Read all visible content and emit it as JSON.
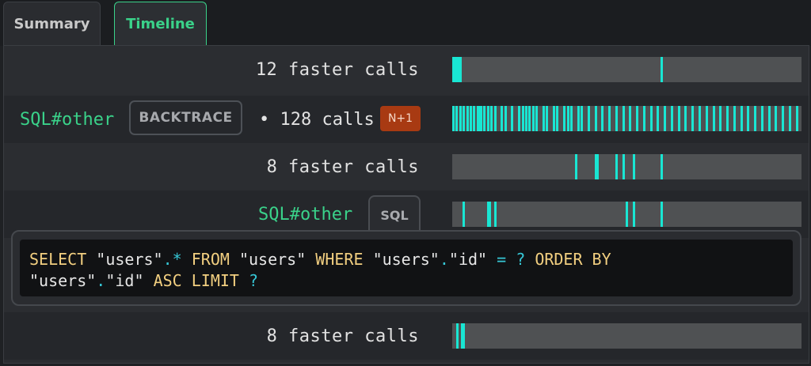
{
  "tabs": [
    {
      "label": "Summary",
      "active": false
    },
    {
      "label": "Timeline",
      "active": true
    }
  ],
  "rows": {
    "row1": {
      "text": "12 faster calls",
      "marks": [
        0.0,
        0.005,
        0.01,
        0.015,
        0.02,
        0.6
      ]
    },
    "row2": {
      "name": "SQL#other",
      "backtrace_label": "BACKTRACE",
      "calls_text": "• 128 calls",
      "badge": "N+1",
      "marks": [
        0.0,
        0.01,
        0.02,
        0.03,
        0.04,
        0.05,
        0.06,
        0.07,
        0.075,
        0.08,
        0.09,
        0.1,
        0.11,
        0.12,
        0.14,
        0.15,
        0.17,
        0.19,
        0.2,
        0.21,
        0.22,
        0.23,
        0.24,
        0.26,
        0.27,
        0.29,
        0.3,
        0.32,
        0.33,
        0.34,
        0.36,
        0.37,
        0.39,
        0.41,
        0.43,
        0.45,
        0.47,
        0.49,
        0.51,
        0.53,
        0.55,
        0.57,
        0.59,
        0.61,
        0.63,
        0.65,
        0.67,
        0.69,
        0.71,
        0.73,
        0.75,
        0.77,
        0.79,
        0.81,
        0.83,
        0.85,
        0.87,
        0.89,
        0.91,
        0.93,
        0.95,
        0.97,
        0.99
      ]
    },
    "row3": {
      "text": "8 faster calls",
      "marks": [
        0.355,
        0.41,
        0.415,
        0.47,
        0.49,
        0.52,
        0.6
      ]
    },
    "row4": {
      "name": "SQL#other",
      "sql_tab_label": "SQL",
      "marks": [
        0.03,
        0.1,
        0.105,
        0.12,
        0.5,
        0.52,
        0.6
      ]
    },
    "row6": {
      "text": "8 faster calls",
      "marks": [
        0.012,
        0.025,
        0.03
      ]
    }
  },
  "sql": {
    "line1": [
      "SELECT",
      "\"users\"",
      ".*",
      "FROM",
      "\"users\"",
      "WHERE",
      "\"users\"",
      ".",
      "\"id\"",
      "=",
      "?",
      "ORDER BY"
    ],
    "line2": [
      "\"users\"",
      ".",
      "\"id\"",
      "ASC",
      "LIMIT",
      "?"
    ]
  },
  "colors": {
    "accent": "#3ad28a",
    "mark": "#19e6d3",
    "badge": "#a83a12"
  }
}
